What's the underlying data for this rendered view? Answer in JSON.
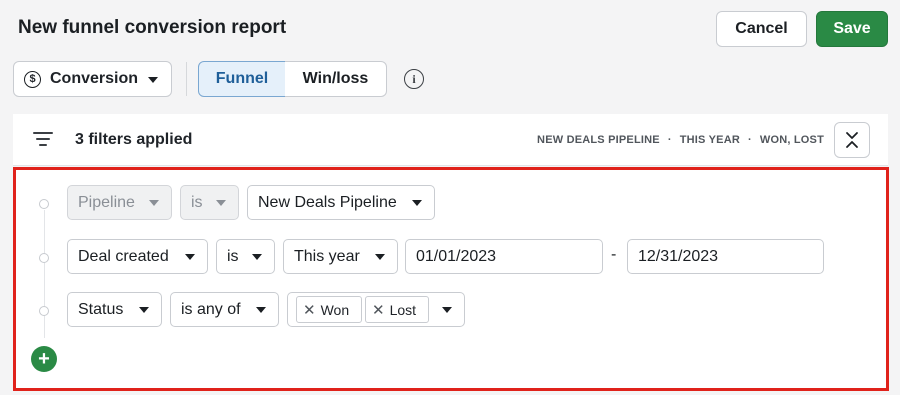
{
  "header": {
    "title": "New funnel conversion report",
    "cancel_label": "Cancel",
    "save_label": "Save"
  },
  "toolbar": {
    "report_type": "Conversion",
    "view_tabs": [
      {
        "label": "Funnel",
        "selected": true
      },
      {
        "label": "Win/loss",
        "selected": false
      }
    ],
    "info_glyph": "i"
  },
  "filter_bar": {
    "count_label": "3 filters applied",
    "summary": [
      "NEW DEALS PIPELINE",
      "THIS YEAR",
      "WON, LOST"
    ],
    "separator": "·"
  },
  "filters": [
    {
      "field": "Pipeline",
      "operator": "is",
      "value": "New Deals Pipeline",
      "locked": true
    },
    {
      "field": "Deal created",
      "operator": "is",
      "value": "This year",
      "from": "01/01/2023",
      "range_sep": "-",
      "to": "12/31/2023"
    },
    {
      "field": "Status",
      "operator": "is any of",
      "tags": [
        "Won",
        "Lost"
      ]
    }
  ],
  "add_filter_label": "+",
  "colors": {
    "accent_green": "#2a8a45",
    "selected_tab_bg": "#e5f0fa",
    "selected_tab_text": "#1f5f99",
    "highlight_border": "#e0221b"
  },
  "icons": {
    "report_type": "dollar-circle-icon",
    "info": "info-icon",
    "filter": "filter-lines-icon",
    "collapse": "collapse-chevrons-icon",
    "tag_remove": "close-icon",
    "add": "plus-icon"
  }
}
